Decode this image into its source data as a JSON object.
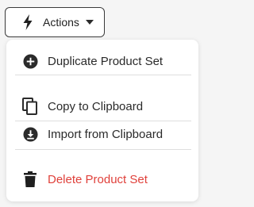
{
  "actions_button": {
    "label": "Actions",
    "icon": "bolt-icon"
  },
  "menu": {
    "items": [
      {
        "label": "Duplicate Product Set",
        "icon": "plus-circle-icon"
      },
      {
        "label": "Copy to Clipboard",
        "icon": "copy-icon"
      },
      {
        "label": "Import from Clipboard",
        "icon": "download-circle-icon"
      },
      {
        "label": "Delete Product Set",
        "icon": "trash-icon",
        "color": "#e0413b"
      }
    ]
  }
}
